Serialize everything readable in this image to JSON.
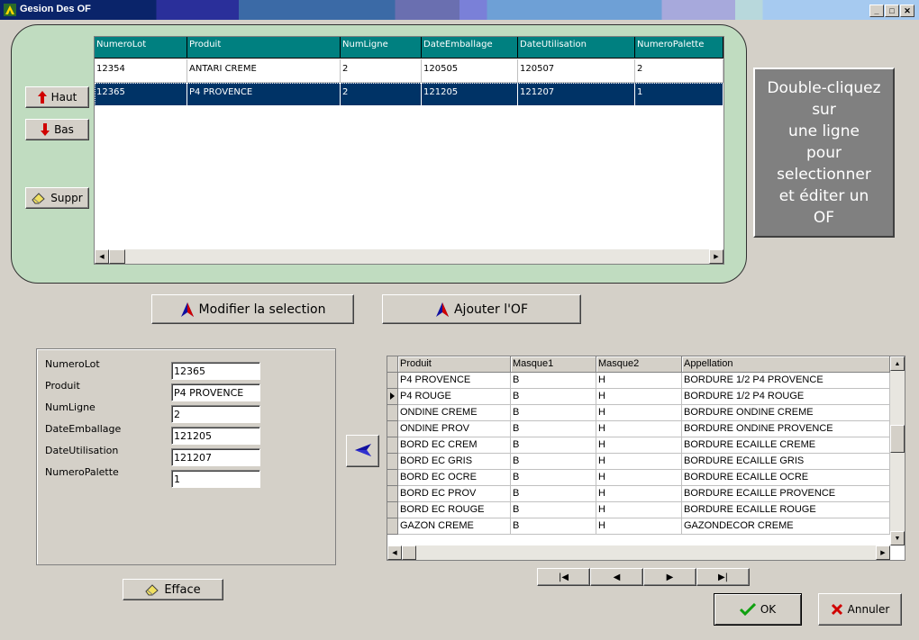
{
  "window": {
    "title": "Gesion Des OF"
  },
  "left_buttons": {
    "haut": "Haut",
    "bas": "Bas",
    "suppr": "Suppr"
  },
  "top_grid": {
    "columns": [
      "NumeroLot",
      "Produit",
      "NumLigne",
      "DateEmballage",
      "DateUtilisation",
      "NumeroPalette"
    ],
    "rows": [
      [
        "12354",
        "ANTARI CREME",
        "2",
        "120505",
        "120507",
        "2"
      ],
      [
        "12365",
        "P4 PROVENCE",
        "2",
        "121205",
        "121207",
        "1"
      ]
    ],
    "selected_row": 1
  },
  "hint": {
    "lines": [
      "Double-cliquez",
      "sur",
      "une ligne",
      "pour",
      "selectionner",
      "et éditer un",
      "OF"
    ]
  },
  "actions": {
    "modify": "Modifier la  selection",
    "add": "Ajouter l'OF"
  },
  "edit_form": {
    "fields": [
      {
        "label": "NumeroLot",
        "value": "12365"
      },
      {
        "label": "Produit",
        "value": "P4 PROVENCE"
      },
      {
        "label": "NumLigne",
        "value": "2"
      },
      {
        "label": "DateEmballage",
        "value": "121205"
      },
      {
        "label": "DateUtilisation",
        "value": "121207"
      },
      {
        "label": "NumeroPalette",
        "value": "1"
      }
    ],
    "clear_label": "Efface"
  },
  "bottom_grid": {
    "columns": [
      "Produit",
      "Masque1",
      "Masque2",
      "Appellation"
    ],
    "rows": [
      [
        "P4 PROVENCE",
        "B",
        "H",
        "BORDURE 1/2 P4 PROVENCE"
      ],
      [
        "P4 ROUGE",
        "B",
        "H",
        "BORDURE 1/2 P4 ROUGE"
      ],
      [
        "ONDINE CREME",
        "B",
        "H",
        "BORDURE ONDINE CREME"
      ],
      [
        "ONDINE PROV",
        "B",
        "H",
        "BORDURE ONDINE PROVENCE"
      ],
      [
        "BORD EC CREM",
        "B",
        "H",
        "BORDURE ECAILLE CREME"
      ],
      [
        "BORD EC GRIS",
        "B",
        "H",
        "BORDURE ECAILLE GRIS"
      ],
      [
        "BORD EC OCRE",
        "B",
        "H",
        "BORDURE ECAILLE OCRE"
      ],
      [
        "BORD EC PROV",
        "B",
        "H",
        "BORDURE ECAILLE PROVENCE"
      ],
      [
        "BORD EC ROUGE",
        "B",
        "H",
        "BORDURE ECAILLE ROUGE"
      ],
      [
        "GAZON CREME",
        "B",
        "H",
        "GAZONDECOR CREME"
      ]
    ],
    "current_row": 1
  },
  "dialog": {
    "ok": "OK",
    "cancel": "Annuler"
  },
  "colors": {
    "grid_header": "#008080",
    "selection": "#003366",
    "panel_green": "#c0dcc0"
  }
}
